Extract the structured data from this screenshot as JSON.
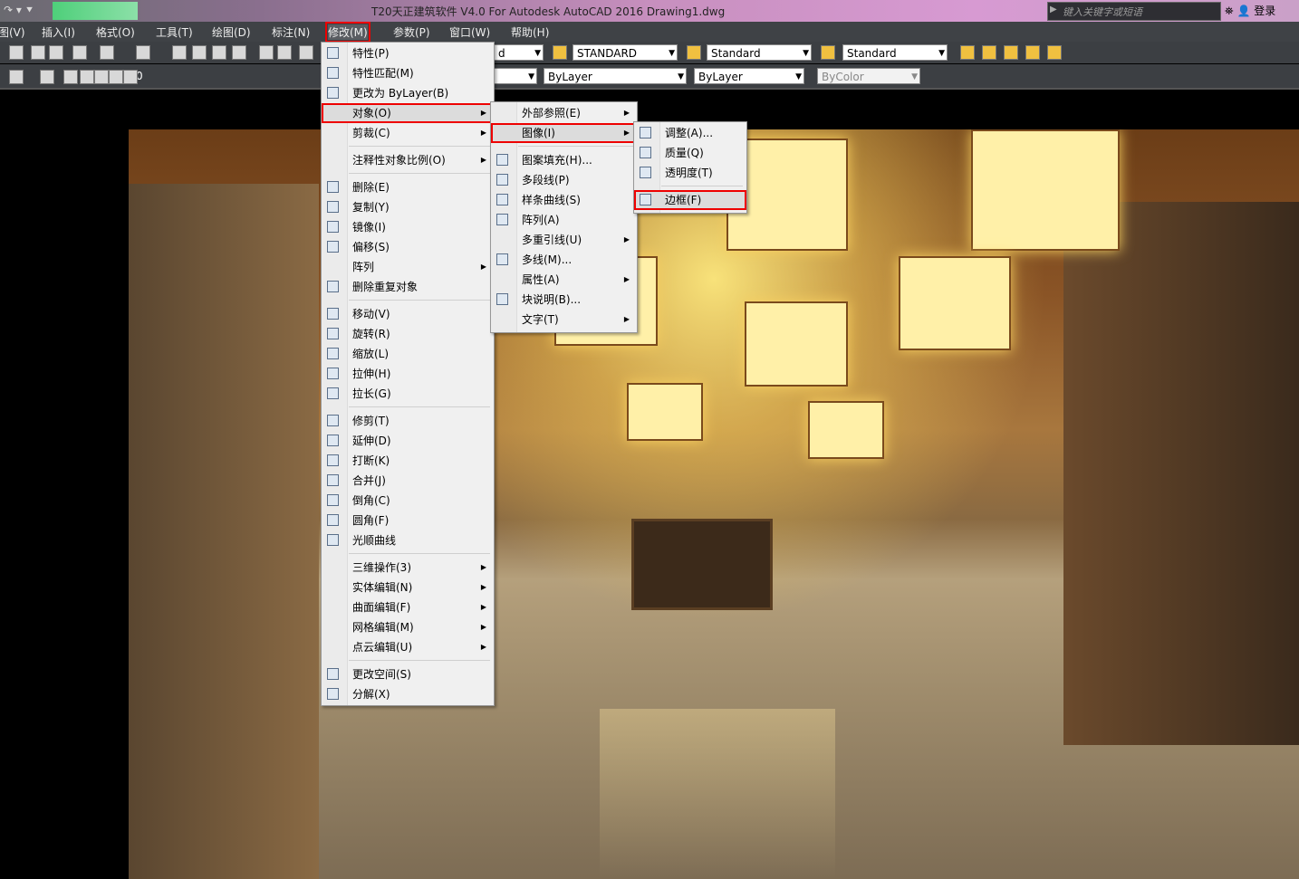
{
  "titlebar": {
    "qat": "↷ ▾ ⯆",
    "title": "T20天正建筑软件 V4.0 For Autodesk AutoCAD 2016    Drawing1.dwg",
    "search_placeholder": "键入关键字或短语",
    "binoculars_icon": "binoculars-icon",
    "user_icon": "user-icon",
    "login": "登录"
  },
  "menubar": [
    "图(V)",
    "插入(I)",
    "格式(O)",
    "工具(T)",
    "绘图(D)",
    "标注(N)",
    "修改(M)",
    "参数(P)",
    "窗口(W)",
    "帮助(H)"
  ],
  "toolbar": {
    "layer_value": "0",
    "text_style": "d",
    "dim_style": "STANDARD",
    "table_style": "Standard",
    "mleader_style": "Standard",
    "color": "ByLayer",
    "linetype": "ByLayer",
    "lineweight": "ByLayer",
    "plotstyle": "ByColor"
  },
  "modify_menu": [
    {
      "label": "特性(P)",
      "icon": "properties-icon"
    },
    {
      "label": "特性匹配(M)",
      "icon": "match-properties-icon"
    },
    {
      "label": "更改为 ByLayer(B)",
      "icon": "bylayer-icon"
    },
    {
      "label": "对象(O)",
      "sub": true,
      "selected": true
    },
    {
      "label": "剪裁(C)",
      "sub": true
    },
    {
      "sep": true
    },
    {
      "label": "注释性对象比例(O)",
      "sub": true
    },
    {
      "sep": true
    },
    {
      "label": "删除(E)",
      "icon": "erase-icon"
    },
    {
      "label": "复制(Y)",
      "icon": "copy-icon"
    },
    {
      "label": "镜像(I)",
      "icon": "mirror-icon"
    },
    {
      "label": "偏移(S)",
      "icon": "offset-icon"
    },
    {
      "label": "阵列",
      "sub": true
    },
    {
      "label": "删除重复对象",
      "icon": "overkill-icon"
    },
    {
      "sep": true
    },
    {
      "label": "移动(V)",
      "icon": "move-icon"
    },
    {
      "label": "旋转(R)",
      "icon": "rotate-icon"
    },
    {
      "label": "缩放(L)",
      "icon": "scale-icon"
    },
    {
      "label": "拉伸(H)",
      "icon": "stretch-icon"
    },
    {
      "label": "拉长(G)",
      "icon": "lengthen-icon"
    },
    {
      "sep": true
    },
    {
      "label": "修剪(T)",
      "icon": "trim-icon"
    },
    {
      "label": "延伸(D)",
      "icon": "extend-icon"
    },
    {
      "label": "打断(K)",
      "icon": "break-icon"
    },
    {
      "label": "合并(J)",
      "icon": "join-icon"
    },
    {
      "label": "倒角(C)",
      "icon": "chamfer-icon"
    },
    {
      "label": "圆角(F)",
      "icon": "fillet-icon"
    },
    {
      "label": "光顺曲线",
      "icon": "blend-icon"
    },
    {
      "sep": true
    },
    {
      "label": "三维操作(3)",
      "sub": true
    },
    {
      "label": "实体编辑(N)",
      "sub": true
    },
    {
      "label": "曲面编辑(F)",
      "sub": true
    },
    {
      "label": "网格编辑(M)",
      "sub": true
    },
    {
      "label": "点云编辑(U)",
      "sub": true
    },
    {
      "sep": true
    },
    {
      "label": "更改空间(S)",
      "icon": "change-space-icon"
    },
    {
      "label": "分解(X)",
      "icon": "explode-icon"
    }
  ],
  "object_menu": [
    {
      "label": "外部参照(E)",
      "sub": true
    },
    {
      "label": "图像(I)",
      "sub": true,
      "selected": true
    },
    {
      "sep": true
    },
    {
      "label": "图案填充(H)...",
      "icon": "hatch-edit-icon"
    },
    {
      "label": "多段线(P)",
      "icon": "pedit-icon"
    },
    {
      "label": "样条曲线(S)",
      "icon": "spline-edit-icon"
    },
    {
      "label": "阵列(A)",
      "icon": "array-edit-icon"
    },
    {
      "label": "多重引线(U)",
      "sub": true
    },
    {
      "label": "多线(M)...",
      "icon": "mline-edit-icon"
    },
    {
      "label": "属性(A)",
      "sub": true
    },
    {
      "label": "块说明(B)...",
      "icon": "block-desc-icon"
    },
    {
      "label": "文字(T)",
      "sub": true
    }
  ],
  "image_menu": [
    {
      "label": "调整(A)...",
      "icon": "image-adjust-icon"
    },
    {
      "label": "质量(Q)",
      "icon": "image-quality-icon"
    },
    {
      "label": "透明度(T)",
      "icon": "transparency-icon"
    },
    {
      "sep": true
    },
    {
      "label": "边框(F)",
      "icon": "frame-icon",
      "selected": true
    }
  ]
}
